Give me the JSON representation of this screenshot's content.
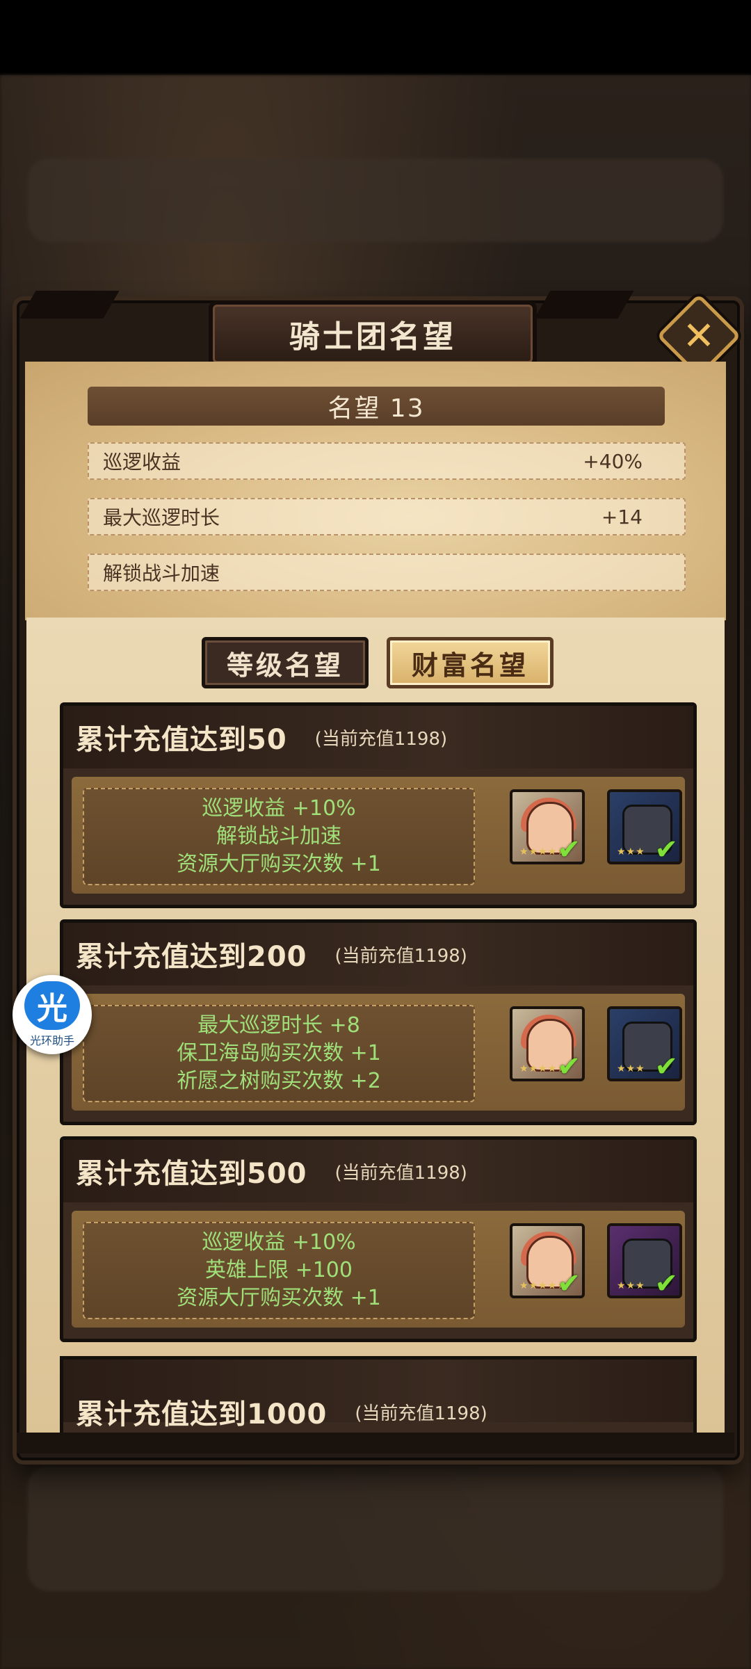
{
  "title": "骑士团名望",
  "close_label": "✕",
  "fame": {
    "header": "名望 13",
    "rows": [
      {
        "label": "巡逻收益",
        "value": "+40%"
      },
      {
        "label": "最大巡逻时长",
        "value": "+14"
      },
      {
        "label": "解锁战斗加速",
        "value": ""
      }
    ]
  },
  "tabs": [
    {
      "label": "等级名望",
      "active": false
    },
    {
      "label": "财富名望",
      "active": true
    }
  ],
  "tiers": [
    {
      "title": "累计充值达到50",
      "current": "(当前充值1198)",
      "rewards": [
        "巡逻收益 +10%",
        "解锁战斗加速",
        "资源大厅购买次数 +1"
      ],
      "heroes": [
        "hero-portrait-girl",
        "hero-portrait-armor-blue"
      ]
    },
    {
      "title": "累计充值达到200",
      "current": "(当前充值1198)",
      "rewards": [
        "最大巡逻时长 +8",
        "保卫海岛购买次数 +1",
        "祈愿之树购买次数 +2"
      ],
      "heroes": [
        "hero-portrait-girl",
        "hero-portrait-knight-blue"
      ]
    },
    {
      "title": "累计充值达到500",
      "current": "(当前充值1198)",
      "rewards": [
        "巡逻收益 +10%",
        "英雄上限 +100",
        "资源大厅购买次数 +1"
      ],
      "heroes": [
        "hero-portrait-girl",
        "hero-portrait-armor-purple"
      ]
    }
  ],
  "partial_tier": {
    "title": "累计充值达到1000",
    "current": "(当前充值1198)"
  },
  "assistant": {
    "logo": "光",
    "label": "光环助手"
  },
  "colors": {
    "reward_text": "#9fe07a",
    "check": "#7fe03a",
    "accent_gold": "#f0c060"
  }
}
